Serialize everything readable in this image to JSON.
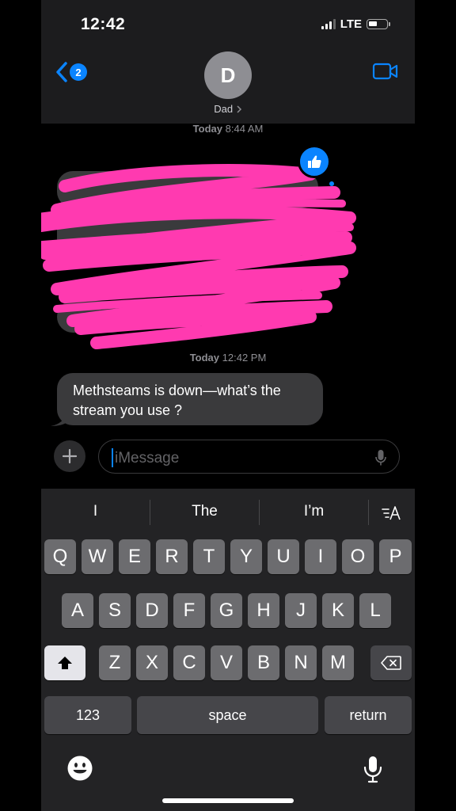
{
  "status_bar": {
    "time": "12:42",
    "network": "LTE",
    "icons": [
      "signal-icon",
      "battery-icon"
    ]
  },
  "header": {
    "back_count": "2",
    "avatar_initial": "D",
    "contact_name": "Dad",
    "icons": [
      "chevron-left-icon",
      "chevron-right-icon",
      "video-camera-icon"
    ]
  },
  "conversation": {
    "timestamp_1": {
      "day": "Today",
      "time": "8:44 AM"
    },
    "tapback": "thumbs-up-icon",
    "redacted_note": "",
    "timestamp_2": {
      "day": "Today",
      "time": "12:42 PM"
    },
    "message": "Methsteams is down—what’s the stream you use ?"
  },
  "composer": {
    "placeholder": "iMessage",
    "icons": [
      "plus-icon",
      "microphone-icon"
    ]
  },
  "keyboard": {
    "suggestions": [
      "I",
      "The",
      "I’m"
    ],
    "row1": [
      "Q",
      "W",
      "E",
      "R",
      "T",
      "Y",
      "U",
      "I",
      "O",
      "P"
    ],
    "row2": [
      "A",
      "S",
      "D",
      "F",
      "G",
      "H",
      "J",
      "K",
      "L"
    ],
    "row3": [
      "Z",
      "X",
      "C",
      "V",
      "B",
      "N",
      "M"
    ],
    "numbers_label": "123",
    "space_label": "space",
    "return_label": "return",
    "icons": [
      "format-text-icon",
      "shift-icon",
      "delete-icon",
      "emoji-icon",
      "dictation-icon"
    ]
  },
  "colors": {
    "accent": "#0a84ff",
    "bubble": "#3a3a3c",
    "redaction": "#ff3ab0"
  }
}
